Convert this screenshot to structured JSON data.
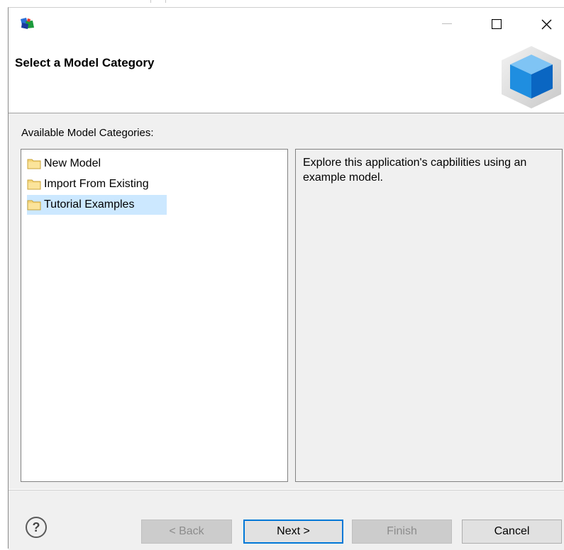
{
  "window": {
    "header_title": "Select a Model Category"
  },
  "body": {
    "section_label": "Available Model Categories:",
    "categories": [
      {
        "label": "New Model",
        "selected": false
      },
      {
        "label": "Import From Existing",
        "selected": false
      },
      {
        "label": "Tutorial Examples",
        "selected": true
      }
    ],
    "description": "Explore this application's capbilities using an example model."
  },
  "footer": {
    "help_label": "?",
    "back_label": "< Back",
    "next_label": "Next >",
    "finish_label": "Finish",
    "cancel_label": "Cancel"
  },
  "icons": {
    "app": "app-logo-icon",
    "minimize": "minimize-icon",
    "maximize": "maximize-icon",
    "close": "close-icon",
    "folder": "folder-icon",
    "header": "cube-icon",
    "help": "help-icon"
  },
  "colors": {
    "selection": "#cce8ff",
    "default_button_border": "#0078d7",
    "panel_bg": "#f0f0f0"
  }
}
